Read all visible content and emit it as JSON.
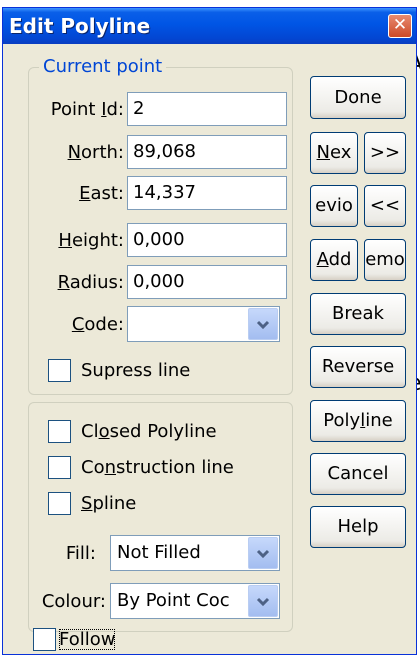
{
  "background": {
    "char_a": "A",
    "char_e": "e"
  },
  "window": {
    "title": "Edit Polyline",
    "close_icon": "close-icon",
    "accent": "#0055e5"
  },
  "current_point": {
    "legend": "Current point",
    "point_id": {
      "label_pre": "Point ",
      "label_key": "I",
      "label_post": "d:",
      "value": "2"
    },
    "north": {
      "label_pre": "",
      "label_key": "N",
      "label_post": "orth:",
      "value": "89,068"
    },
    "east": {
      "label_pre": "",
      "label_key": "E",
      "label_post": "ast:",
      "value": "14,337"
    },
    "height": {
      "label_pre": "",
      "label_key": "H",
      "label_post": "eight:",
      "value": "0,000"
    },
    "radius": {
      "label_pre": "",
      "label_key": "R",
      "label_post": "adius:",
      "value": "0,000"
    },
    "code": {
      "label_pre": "",
      "label_key": "C",
      "label_post": "ode:",
      "value": ""
    },
    "supress_line": "Supress line"
  },
  "options": {
    "closed_polyline": {
      "pre": "Cl",
      "key": "o",
      "post": "sed Polyline"
    },
    "construction_line": {
      "pre": "Co",
      "key": "n",
      "post": "struction line"
    },
    "spline": {
      "pre": "",
      "key": "S",
      "post": "pline"
    },
    "fill": {
      "label": "Fill:",
      "value": "Not Filled"
    },
    "colour": {
      "label": "Colour:",
      "value": "By Point Coc"
    }
  },
  "follow": "Follow",
  "buttons": {
    "done": "Done",
    "next": {
      "key": "N",
      "post": "ex"
    },
    "next_fast": ">>",
    "previous": "evio",
    "previous_fast": "<<",
    "add": {
      "key": "A",
      "post": "dd"
    },
    "remove": "emo",
    "break": "Break",
    "reverse": "Reverse",
    "polyline": {
      "pre": "Poly",
      "key": "l",
      "post": "ine"
    },
    "cancel": "Cancel",
    "help": "Help"
  }
}
